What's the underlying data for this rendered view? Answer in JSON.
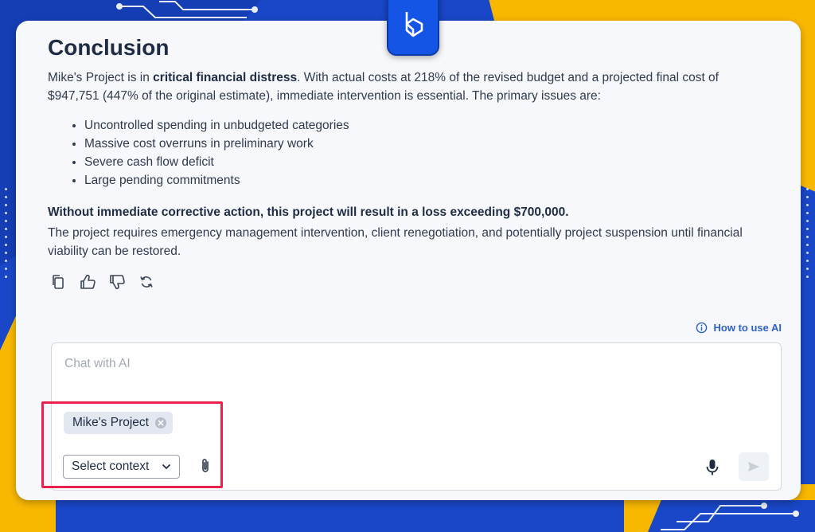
{
  "conclusion": {
    "title": "Conclusion",
    "intro_prefix": "Mike's Project is in ",
    "intro_bold": "critical financial distress",
    "intro_suffix": ". With actual costs at 218% of the revised budget and a projected final cost of $947,751 (447% of the original estimate), immediate intervention is essential. The primary issues are:",
    "bullets": [
      "Uncontrolled spending in unbudgeted categories",
      "Massive cost overruns in preliminary work",
      "Severe cash flow deficit",
      "Large pending commitments"
    ],
    "warning": "Without immediate corrective action, this project will result in a loss exceeding $700,000.",
    "recommendation": "The project requires emergency management intervention, client renegotiation, and potentially project suspension until financial viability can be restored."
  },
  "message_actions": [
    "copy-icon",
    "thumbs-up-icon",
    "thumbs-down-icon",
    "regenerate-icon"
  ],
  "help": {
    "label": "How to use AI",
    "icon": "info-icon"
  },
  "chat": {
    "placeholder": "Chat with AI",
    "context_chip": "Mike's Project",
    "select_context": "Select context"
  },
  "colors": {
    "accent": "#2d63c8",
    "highlight": "#e8224c",
    "brand_blue": "#1455e6",
    "bg_yellow": "#f9b800"
  }
}
